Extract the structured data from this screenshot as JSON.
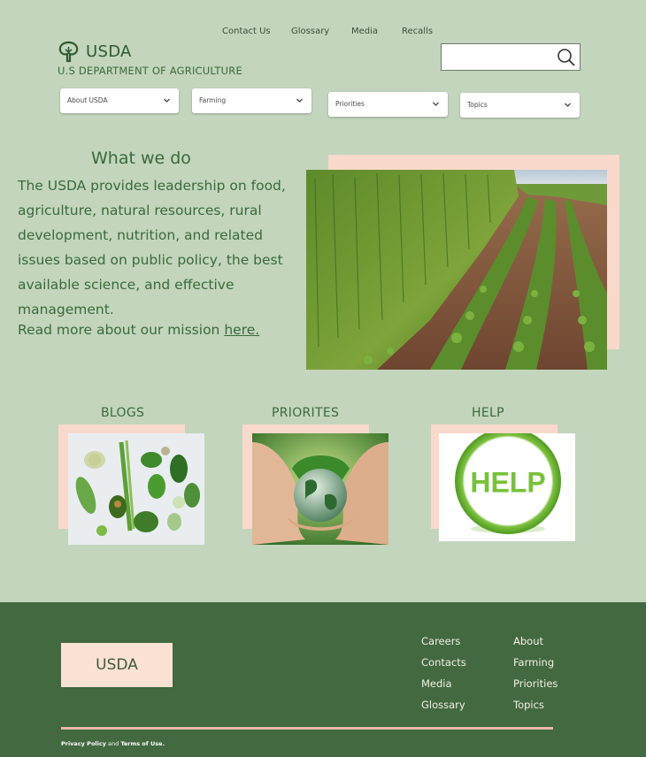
{
  "top_links": [
    "Contact Us",
    "Glossary",
    "Media",
    "Recalls"
  ],
  "logo": {
    "text": "USDA",
    "department": "U.S DEPARTMENT OF AGRICULTURE"
  },
  "search": {
    "value": "",
    "placeholder": ""
  },
  "dropdowns": [
    "About USDA",
    "Farming",
    "Priorities",
    "Topics"
  ],
  "mission": {
    "title": "What we do",
    "body": "The USDA provides leadership on food, agriculture, natural resources, rural development, nutrition, and related issues based on public policy, the best available science, and effective management.",
    "more_prefix": "Read more about our mission ",
    "more_link": "here. "
  },
  "cards": [
    {
      "title": "BLOGS"
    },
    {
      "title": "PRIORITES"
    },
    {
      "title": "HELP",
      "image_text": "HELP"
    }
  ],
  "footer": {
    "logo": "USDA",
    "col1": [
      "Careers",
      "Contacts",
      "Media",
      "Glossary"
    ],
    "col2": [
      "About",
      "Farming",
      "Priorities",
      "Topics"
    ],
    "legal": {
      "privacy": "Privacy Policy",
      "and": " and ",
      "terms": "Terms of Use."
    }
  },
  "colors": {
    "page_bg": "#c3d5bd",
    "footer_bg": "#426940",
    "accent_peach": "#f9d9cb",
    "text_green": "#3a6a3a"
  }
}
